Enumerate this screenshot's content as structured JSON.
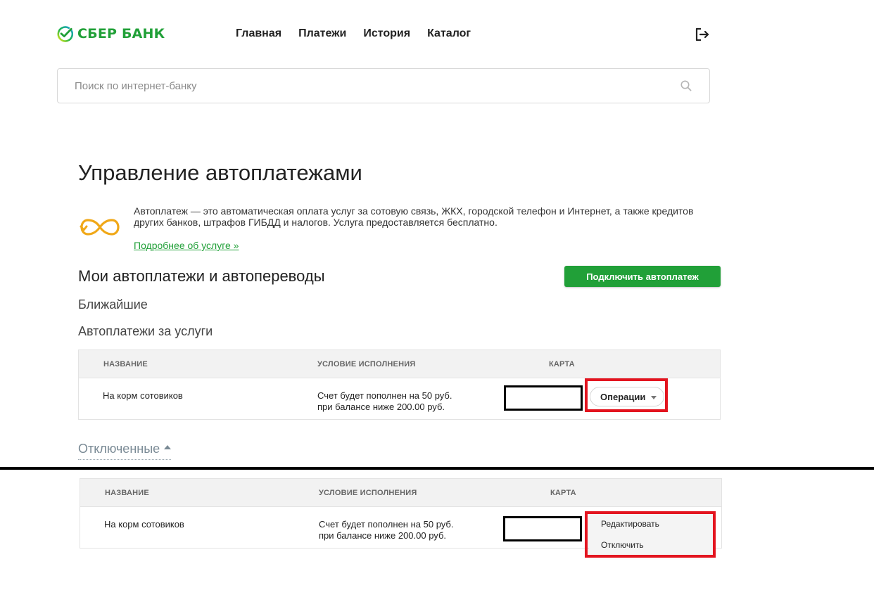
{
  "brand": {
    "name": "СБЕР БАНК",
    "color": "#21a038"
  },
  "nav": [
    "Главная",
    "Платежи",
    "История",
    "Каталог"
  ],
  "header": {
    "logout_icon": "logout-icon"
  },
  "search": {
    "placeholder": "Поиск по интернет-банку",
    "icon": "search-icon"
  },
  "page": {
    "title": "Управление автоплатежами",
    "info_icon": "infinity-icon",
    "info_text": "Автоплатеж — это автоматическая оплата услуг за сотовую связь, ЖКХ, городской телефон и Интернет, а также кредитов других банков, штрафов ГИБДД и налогов. Услуга предоставляется бесплатно.",
    "info_link": "Подробнее об услуге »"
  },
  "section": {
    "title": "Мои автоплатежи и автопереводы",
    "connect_button": "Подключить автоплатеж",
    "nearest": "Ближайшие",
    "services": "Автоплатежи за услуги",
    "disabled_toggle": "Отключенные"
  },
  "table": {
    "headers": {
      "name": "НАЗВАНИЕ",
      "condition": "УСЛОВИЕ ИСПОЛНЕНИЯ",
      "card": "КАРТА"
    },
    "rows": [
      {
        "name": "На корм сотовиков",
        "condition_line1": "Счет будет пополнен на 50 руб.",
        "condition_line2": "при балансе ниже 200.00 руб.",
        "operations_button": "Операции"
      }
    ]
  },
  "table_bottom": {
    "rows": [
      {
        "name": "На корм сотовиков",
        "condition_line1": "Счет будет пополнен на 50 руб.",
        "condition_line2": "при балансе ниже 200.00 руб."
      }
    ]
  },
  "operations_menu": [
    "Редактировать",
    "Отключить"
  ],
  "colors": {
    "accent": "#21a038",
    "highlight": "#e3141f",
    "muted": "#7a8a95"
  }
}
